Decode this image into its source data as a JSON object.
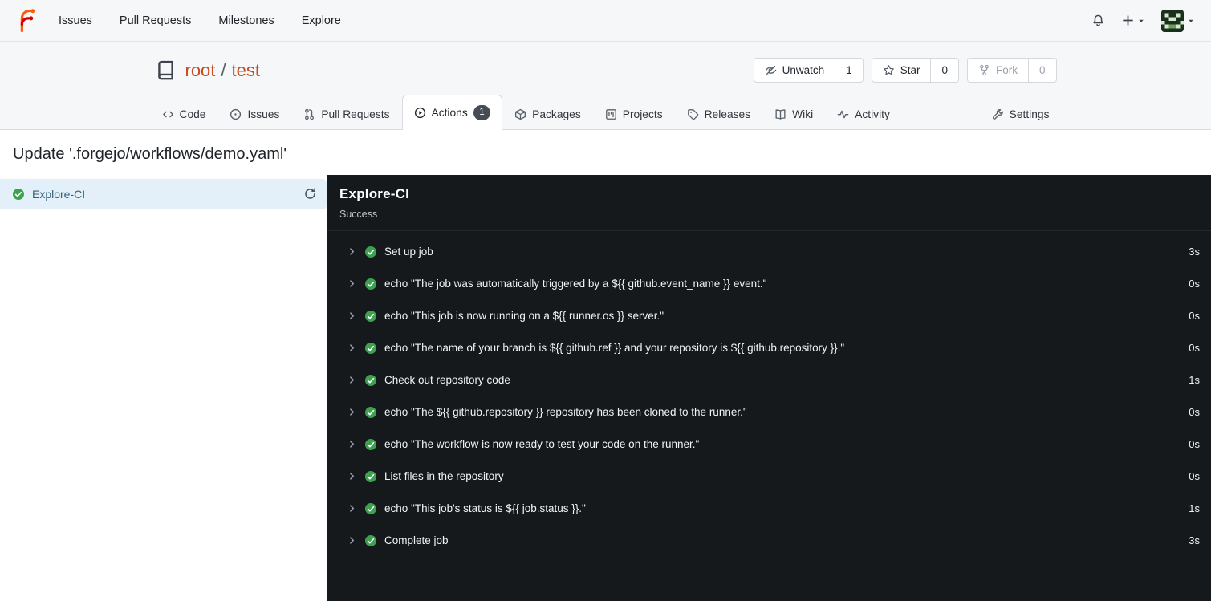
{
  "navbar": {
    "links": [
      "Issues",
      "Pull Requests",
      "Milestones",
      "Explore"
    ]
  },
  "repo": {
    "owner": "root",
    "slash": "/",
    "name": "test",
    "actions": [
      {
        "name": "unwatch",
        "label": "Unwatch",
        "count": "1",
        "icon": "eye-slash",
        "disabled": false
      },
      {
        "name": "star",
        "label": "Star",
        "count": "0",
        "icon": "star",
        "disabled": false
      },
      {
        "name": "fork",
        "label": "Fork",
        "count": "0",
        "icon": "fork",
        "disabled": true
      }
    ]
  },
  "tabs": {
    "items": [
      {
        "id": "code",
        "label": "Code",
        "icon": "code",
        "active": false
      },
      {
        "id": "issues",
        "label": "Issues",
        "icon": "issue",
        "active": false
      },
      {
        "id": "pull-requests",
        "label": "Pull Requests",
        "icon": "pull-request",
        "active": false
      },
      {
        "id": "actions",
        "label": "Actions",
        "icon": "play",
        "badge": "1",
        "active": true
      },
      {
        "id": "packages",
        "label": "Packages",
        "icon": "package",
        "active": false
      },
      {
        "id": "projects",
        "label": "Projects",
        "icon": "project",
        "active": false
      },
      {
        "id": "releases",
        "label": "Releases",
        "icon": "tag",
        "active": false
      },
      {
        "id": "wiki",
        "label": "Wiki",
        "icon": "book",
        "active": false
      },
      {
        "id": "activity",
        "label": "Activity",
        "icon": "pulse",
        "active": false
      }
    ],
    "settings": {
      "id": "settings",
      "label": "Settings",
      "icon": "tools",
      "active": false
    }
  },
  "run": {
    "commit_title": "Update '.forgejo/workflows/demo.yaml'",
    "jobs": [
      {
        "name": "Explore-CI",
        "status": "success",
        "selected": true
      }
    ],
    "detail": {
      "title": "Explore-CI",
      "status_text": "Success",
      "steps": [
        {
          "name": "Set up job",
          "duration": "3s"
        },
        {
          "name": "echo \"The job was automatically triggered by a ${{ github.event_name }} event.\"",
          "duration": "0s"
        },
        {
          "name": "echo \"This job is now running on a ${{ runner.os }} server.\"",
          "duration": "0s"
        },
        {
          "name": "echo \"The name of your branch is ${{ github.ref }} and your repository is ${{ github.repository }}.\"",
          "duration": "0s"
        },
        {
          "name": "Check out repository code",
          "duration": "1s"
        },
        {
          "name": "echo \"The ${{ github.repository }} repository has been cloned to the runner.\"",
          "duration": "0s"
        },
        {
          "name": "echo \"The workflow is now ready to test your code on the runner.\"",
          "duration": "0s"
        },
        {
          "name": "List files in the repository",
          "duration": "0s"
        },
        {
          "name": "echo \"This job's status is ${{ job.status }}.\"",
          "duration": "1s"
        },
        {
          "name": "Complete job",
          "duration": "3s"
        }
      ]
    }
  },
  "colors": {
    "repo_link": "#c64a1e",
    "success_green": "#3ba350",
    "selected_job_bg": "#e3eff9",
    "log_background": "#16191c",
    "tab_badge_bg": "#454c54",
    "header_background": "#f6f7f8"
  }
}
